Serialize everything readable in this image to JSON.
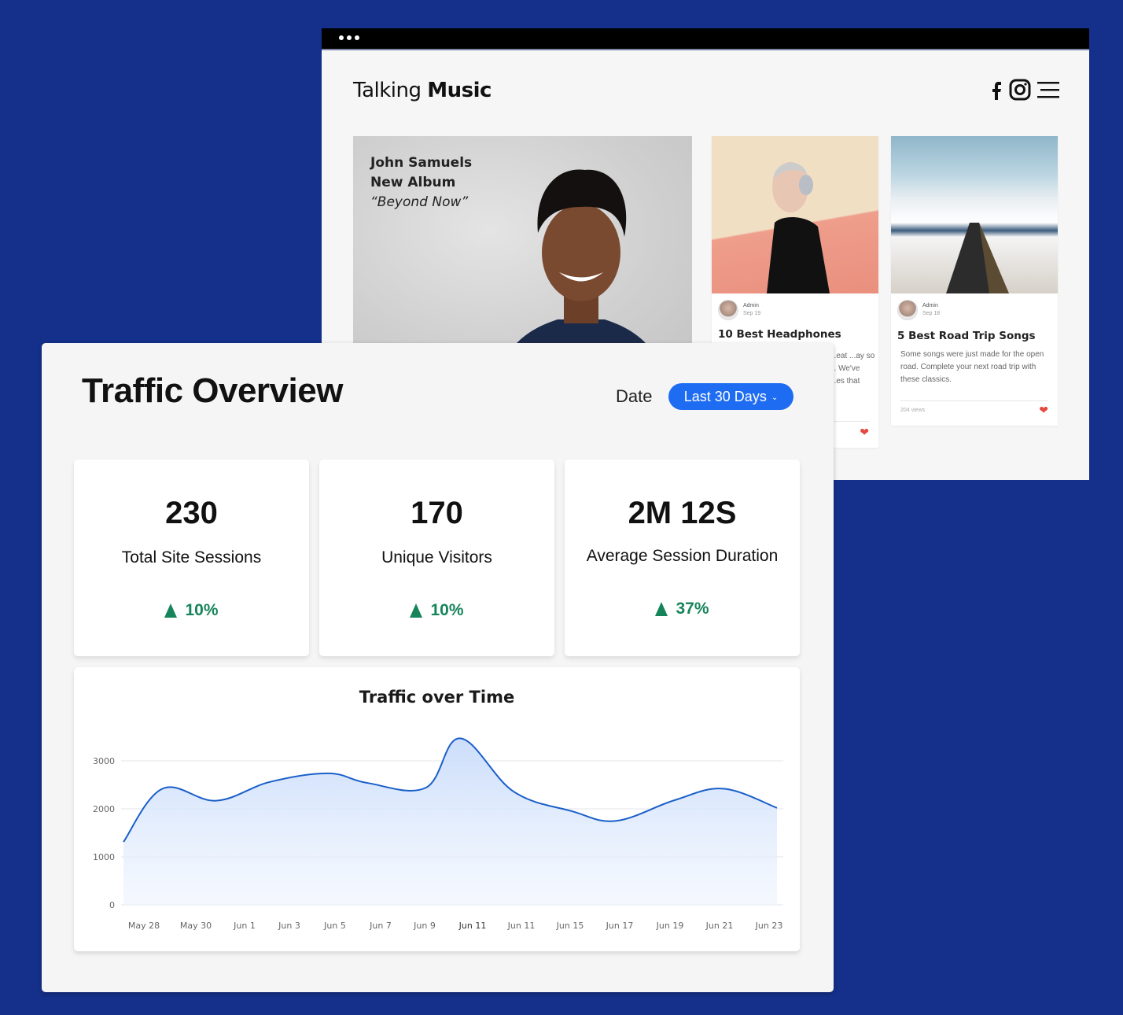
{
  "browser": {
    "site_logo_regular": "Talking ",
    "site_logo_bold": "Music",
    "social_icons": [
      "facebook-icon",
      "instagram-icon",
      "menu-icon"
    ],
    "hero": {
      "line1": "John Samuels",
      "line2": "New Album",
      "line3": "“Beyond Now”"
    },
    "posts": [
      {
        "author": "Admin",
        "date": "Sep 19",
        "title": "10 Best Headphones",
        "excerpt": "...eat ...ay so ... We've ...es that",
        "heart_color": "#e5483f"
      },
      {
        "author": "Admin",
        "date": "Sep 18",
        "title": "5 Best Road Trip Songs",
        "excerpt": "Some songs were just made for the open road. Complete your next road trip with these classics.",
        "views": "204 views",
        "heart_color": "#e5483f"
      }
    ]
  },
  "dashboard": {
    "title": "Traffic Overview",
    "date_label": "Date",
    "date_select": "Last 30 Days",
    "accent_color": "#1e6cf2",
    "positive_color": "#16845a",
    "stats": [
      {
        "value": "230",
        "label": "Total Site Sessions",
        "change": "10%",
        "direction": "up"
      },
      {
        "value": "170",
        "label": "Unique Visitors",
        "change": "10%",
        "direction": "up"
      },
      {
        "value": "2M 12S",
        "label": "Average Session Duration",
        "change": "37%",
        "direction": "up"
      }
    ]
  },
  "chart_data": {
    "type": "area",
    "title": "Traffic over Time",
    "xlabel": "",
    "ylabel": "",
    "ylim": [
      0,
      3000
    ],
    "yticks": [
      0,
      1000,
      2000,
      3000
    ],
    "grid": true,
    "legend": "none",
    "categories": [
      "May 28",
      "May 30",
      "Jun 1",
      "Jun 3",
      "Jun 5",
      "Jun 7",
      "Jun 9",
      "Jun 11",
      "Jun 11",
      "Jun 15",
      "Jun 17",
      "Jun 19",
      "Jun 21",
      "Jun 23"
    ],
    "series": [
      {
        "name": "Traffic",
        "color": "#1a5fc8",
        "x": [
          0,
          0.8,
          1.9,
          3.0,
          4.2,
          5.0,
          6.2,
          6.9,
          8.0,
          9.2,
          10.1,
          11.3,
          12.3,
          13.4
        ],
        "values": [
          1310,
          2420,
          2170,
          2560,
          2740,
          2540,
          2440,
          3470,
          2360,
          1950,
          1750,
          2180,
          2420,
          2020
        ]
      }
    ]
  }
}
